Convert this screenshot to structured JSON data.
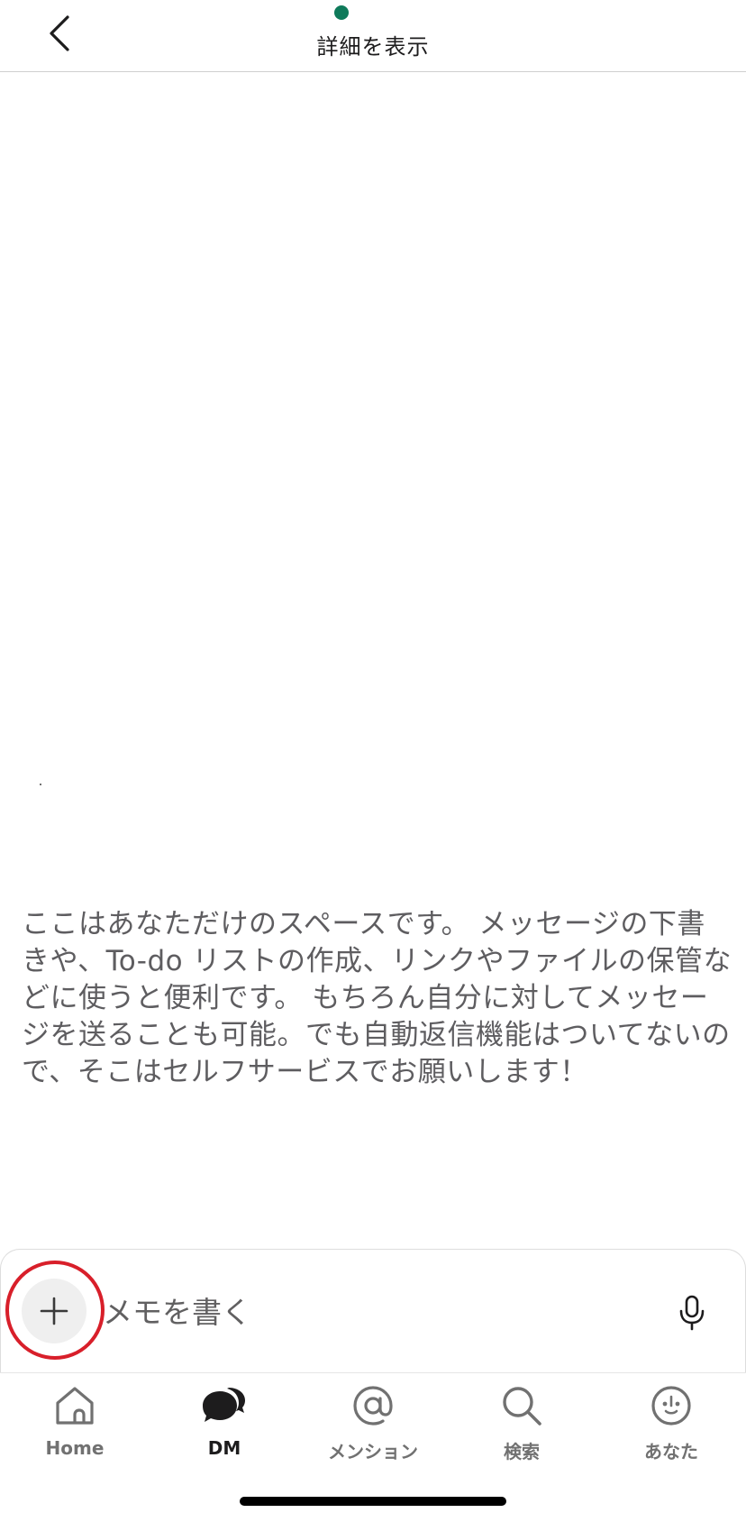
{
  "header": {
    "title": "詳細を表示",
    "status_color": "#0e7a5a"
  },
  "intro_message": "ここはあなただけのスペースです。 メッセージの下書きや、To-do リストの作成、リンクやファイルの保管などに使うと便利です。 もちろん自分に対してメッセージを送ることも可能。でも自動返信機能はついてないので、そこはセルフサービスでお願いします！",
  "composer": {
    "placeholder": "メモを書く",
    "value": "",
    "plus_icon": "plus-icon",
    "mic_icon": "microphone-icon",
    "highlight_color": "#d81f2a"
  },
  "tabs": [
    {
      "label": "Home",
      "icon": "home-icon",
      "active": false
    },
    {
      "label": "DM",
      "icon": "dm-icon",
      "active": true
    },
    {
      "label": "メンション",
      "icon": "mention-icon",
      "active": false
    },
    {
      "label": "検索",
      "icon": "search-icon",
      "active": false
    },
    {
      "label": "あなた",
      "icon": "profile-icon",
      "active": false
    }
  ],
  "colors": {
    "text_primary": "#1d1c1d",
    "text_secondary": "#616061",
    "tab_inactive": "#717171"
  }
}
